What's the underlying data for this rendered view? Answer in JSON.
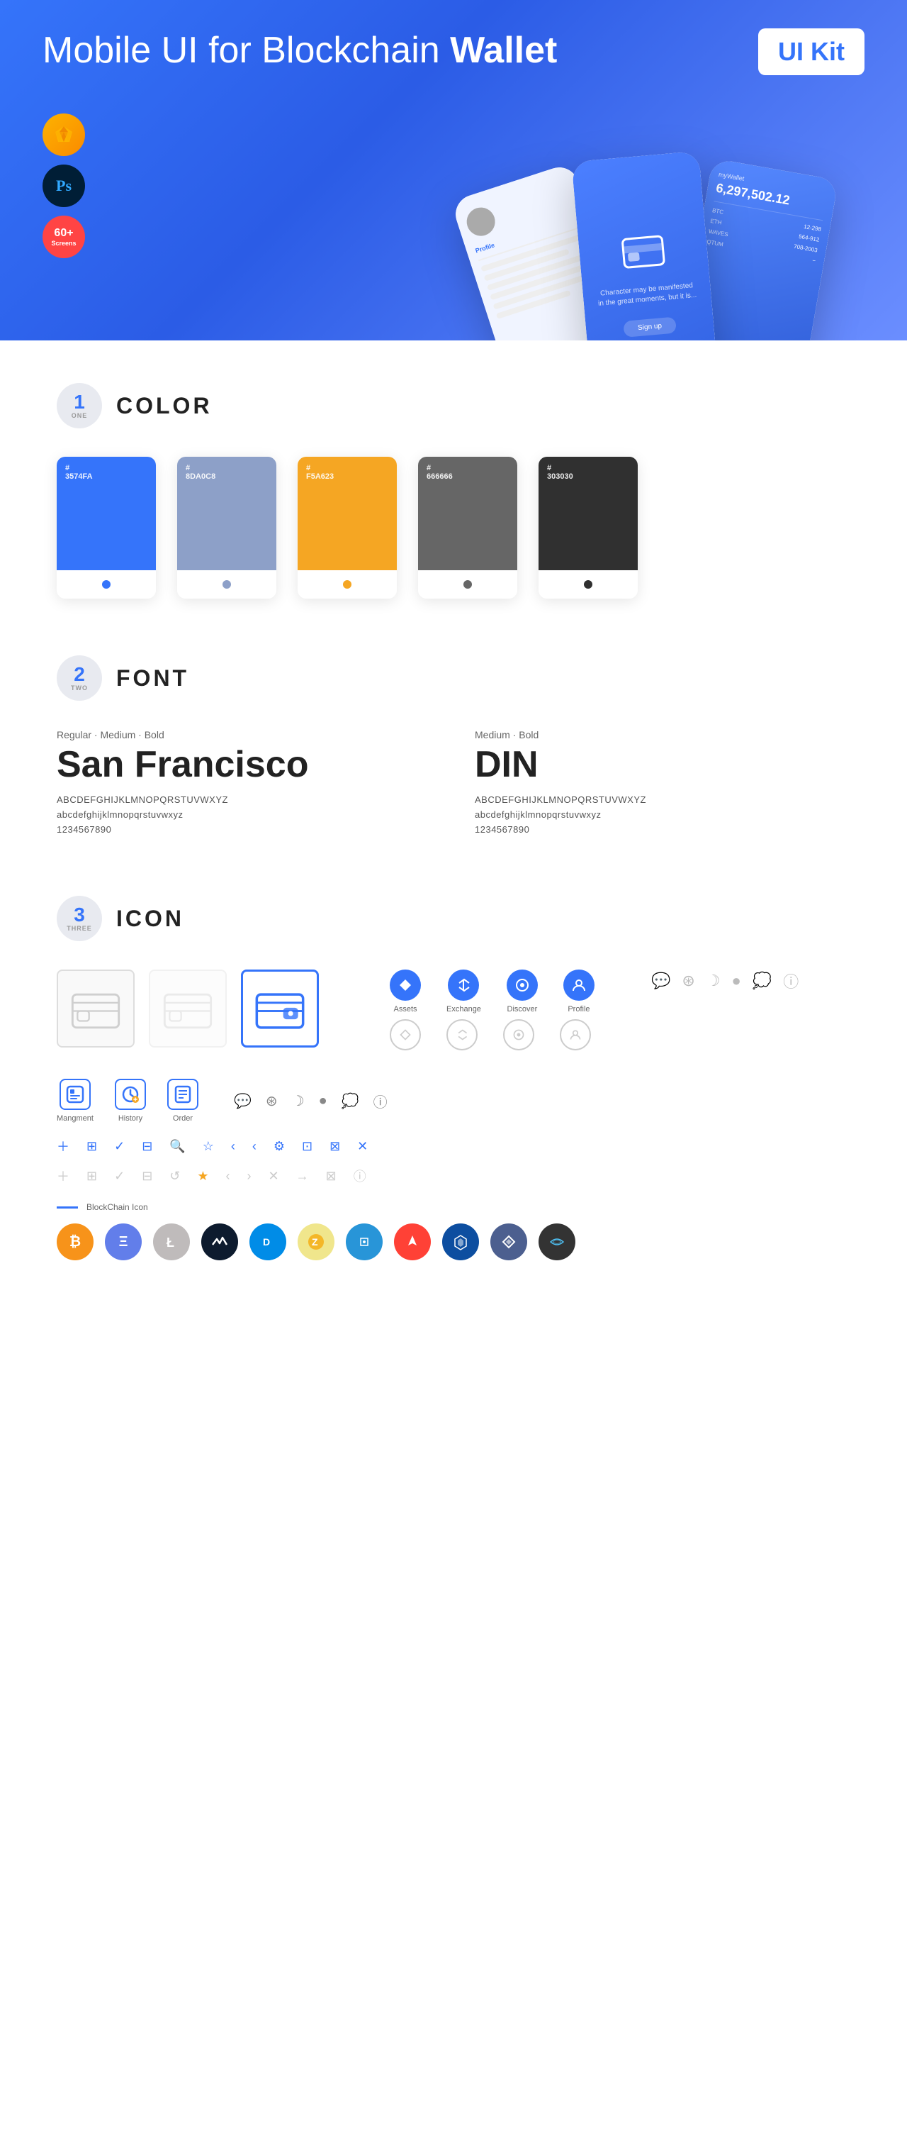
{
  "hero": {
    "title_regular": "Mobile UI for Blockchain ",
    "title_bold": "Wallet",
    "badge": "UI Kit",
    "tool_sketch": "Sketch",
    "tool_ps": "Ps",
    "screens_label": "60+\nScreens"
  },
  "sections": {
    "color": {
      "number": "1",
      "number_text": "ONE",
      "title": "COLOR",
      "swatches": [
        {
          "hex": "#3574FA",
          "label": "#\n3574FA",
          "dot_color": "#1A55D4"
        },
        {
          "hex": "#8DA0C8",
          "label": "#\n8DA0C8",
          "dot_color": "#6B82AA"
        },
        {
          "hex": "#F5A623",
          "label": "#\nF5A623",
          "dot_color": "#D48B10"
        },
        {
          "hex": "#666666",
          "label": "#\n666666",
          "dot_color": "#444444"
        },
        {
          "hex": "#303030",
          "label": "#\n303030",
          "dot_color": "#111111"
        }
      ]
    },
    "font": {
      "number": "2",
      "number_text": "TWO",
      "title": "FONT",
      "font1": {
        "styles": "Regular · Medium · Bold",
        "name": "San Francisco",
        "uppercase": "ABCDEFGHIJKLMNOPQRSTUVWXYZ",
        "lowercase": "abcdefghijklmnopqrstuvwxyz",
        "numbers": "1234567890"
      },
      "font2": {
        "styles": "Medium · Bold",
        "name": "DIN",
        "uppercase": "ABCDEFGHIJKLMNOPQRSTUVWXYZ",
        "lowercase": "abcdefghijklmnopqrstuvwxyz",
        "numbers": "1234567890"
      }
    },
    "icon": {
      "number": "3",
      "number_text": "THREE",
      "title": "ICON",
      "nav_items": [
        {
          "label": "Assets"
        },
        {
          "label": "Exchange"
        },
        {
          "label": "Discover"
        },
        {
          "label": "Profile"
        }
      ],
      "bottom_icons": [
        {
          "label": "Mangment"
        },
        {
          "label": "History"
        },
        {
          "label": "Order"
        }
      ],
      "small_icons": [
        "+",
        "⊞",
        "✓",
        "⊟",
        "🔍",
        "☆",
        "<",
        "<",
        "⚙",
        "⊡",
        "⊠",
        "✕"
      ],
      "small_icons_ghost": [
        "+",
        "⊞",
        "✓",
        "⊟",
        "↺",
        "★",
        "<",
        "<",
        "⊕",
        "→",
        "⊠",
        "ℹ"
      ],
      "blockchain_label": "BlockChain Icon",
      "crypto_coins": [
        {
          "name": "Bitcoin",
          "symbol": "₿",
          "color": "#F7931A"
        },
        {
          "name": "Ethereum",
          "symbol": "Ξ",
          "color": "#627EEA"
        },
        {
          "name": "Litecoin",
          "symbol": "Ł",
          "color": "#BFBBBB"
        },
        {
          "name": "Waves",
          "symbol": "W",
          "color": "#1F4E8C"
        },
        {
          "name": "Dash",
          "symbol": "D",
          "color": "#008CE7"
        },
        {
          "name": "Zcash",
          "symbol": "Z",
          "color": "#F4B728"
        },
        {
          "name": "Qtum",
          "symbol": "Q",
          "color": "#2895D8"
        },
        {
          "name": "Ark",
          "symbol": "A",
          "color": "#FF4136"
        },
        {
          "name": "Lisk",
          "symbol": "L",
          "color": "#0D4EA0"
        },
        {
          "name": "Polymath",
          "symbol": "P",
          "color": "#4C5F8F"
        },
        {
          "name": "POA",
          "symbol": "∞",
          "color": "#5F5F5F"
        }
      ]
    }
  }
}
